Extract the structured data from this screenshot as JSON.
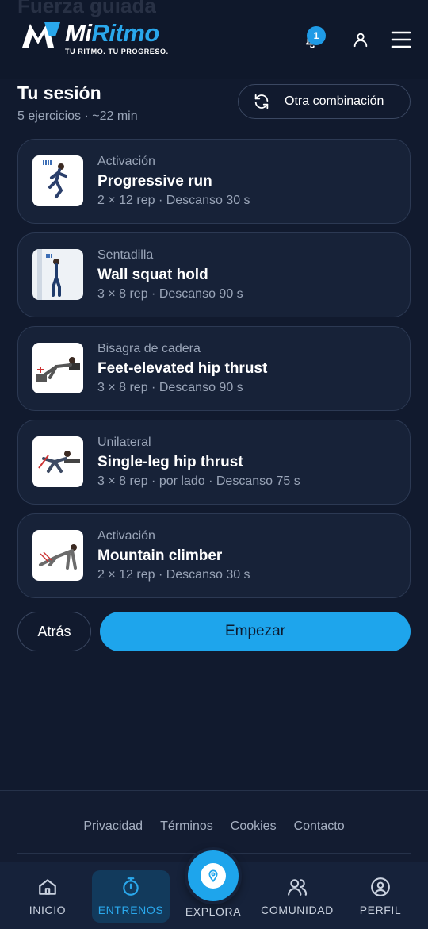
{
  "header": {
    "ghost_title": "Fuerza guiada",
    "brand_prefix": "Mi",
    "brand_suffix": "Ritmo",
    "tagline": "TU RITMO. TU PROGRESO.",
    "notification_count": "1",
    "icons": [
      "bell-icon",
      "user-icon",
      "menu-icon"
    ]
  },
  "session": {
    "title": "Tu sesión",
    "meta": "5 ejercicios · ~22 min",
    "shuffle_label": "Otra combinación"
  },
  "exercises": [
    {
      "category": "Activación",
      "name": "Progressive run",
      "detail": "2 × 12 rep · Descanso 30 s"
    },
    {
      "category": "Sentadilla",
      "name": "Wall squat hold",
      "detail": "3 × 8 rep · Descanso 90 s"
    },
    {
      "category": "Bisagra de cadera",
      "name": "Feet-elevated hip thrust",
      "detail": "3 × 8 rep · Descanso 90 s"
    },
    {
      "category": "Unilateral",
      "name": "Single-leg hip thrust",
      "detail": "3 × 8 rep · por lado · Descanso 75 s"
    },
    {
      "category": "Activación",
      "name": "Mountain climber",
      "detail": "2 × 12 rep · Descanso 30 s"
    }
  ],
  "actions": {
    "back_label": "Atrás",
    "start_label": "Empezar"
  },
  "footer": {
    "links": [
      "Privacidad",
      "Términos",
      "Cookies",
      "Contacto"
    ]
  },
  "nav": {
    "items": [
      {
        "label": "INICIO",
        "icon": "home-icon"
      },
      {
        "label": "ENTRENOS",
        "icon": "stopwatch-icon",
        "active": true
      },
      {
        "label": "EXPLORA",
        "icon": "map-pin-icon"
      },
      {
        "label": "COMUNIDAD",
        "icon": "people-icon"
      },
      {
        "label": "PERFIL",
        "icon": "profile-icon"
      }
    ]
  },
  "colors": {
    "background": "#111a2e",
    "accent": "#1ea5ec",
    "card": "#172238",
    "muted_text": "#9aa5b8"
  }
}
